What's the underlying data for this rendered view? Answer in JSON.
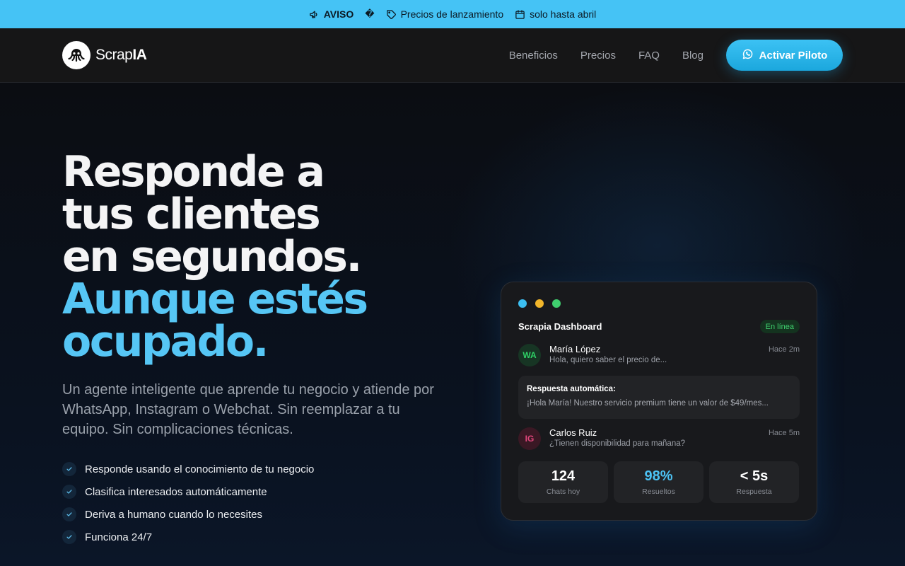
{
  "announcement": {
    "label": "AVISO",
    "separator": "�",
    "promo": "Precios de lanzamiento",
    "deadline": "solo hasta abril"
  },
  "nav": {
    "logo_prefix": "Scrap",
    "logo_suffix": "IA",
    "links": [
      "Beneficios",
      "Precios",
      "FAQ",
      "Blog"
    ],
    "cta": "Activar Piloto"
  },
  "hero": {
    "headline": [
      "Responde a",
      "tus clientes",
      "en segundos."
    ],
    "headline_accent": [
      "Aunque estés",
      "ocupado."
    ],
    "subtitle": "Un agente inteligente que aprende tu negocio y atiende por WhatsApp, Instagram o Webchat. Sin reemplazar a tu equipo. Sin complicaciones técnicas.",
    "features": [
      "Responde usando el conocimiento de tu negocio",
      "Clasifica interesados automáticamente",
      "Deriva a humano cuando lo necesites",
      "Funciona 24/7"
    ]
  },
  "dashboard": {
    "title": "Scrapia Dashboard",
    "status": "En línea",
    "messages": [
      {
        "initials": "WA",
        "name": "María López",
        "text": "Hola, quiero saber el precio de...",
        "time": "Hace 2m"
      },
      {
        "initials": "IG",
        "name": "Carlos Ruiz",
        "text": "¿Tienen disponibilidad para mañana?",
        "time": "Hace 5m"
      }
    ],
    "auto_reply": {
      "label": "Respuesta automática:",
      "text": "¡Hola María! Nuestro servicio premium tiene un valor de $49/mes..."
    },
    "stats": [
      {
        "value": "124",
        "label": "Chats hoy"
      },
      {
        "value": "98%",
        "label": "Resueltos"
      },
      {
        "value": "< 5s",
        "label": "Respuesta"
      }
    ]
  },
  "colors": {
    "accent": "#45c3f5",
    "headline_accent": "#56c6f5",
    "whatsapp": "#2fd166",
    "instagram": "#e0457b",
    "online": "#3fcf6e"
  }
}
